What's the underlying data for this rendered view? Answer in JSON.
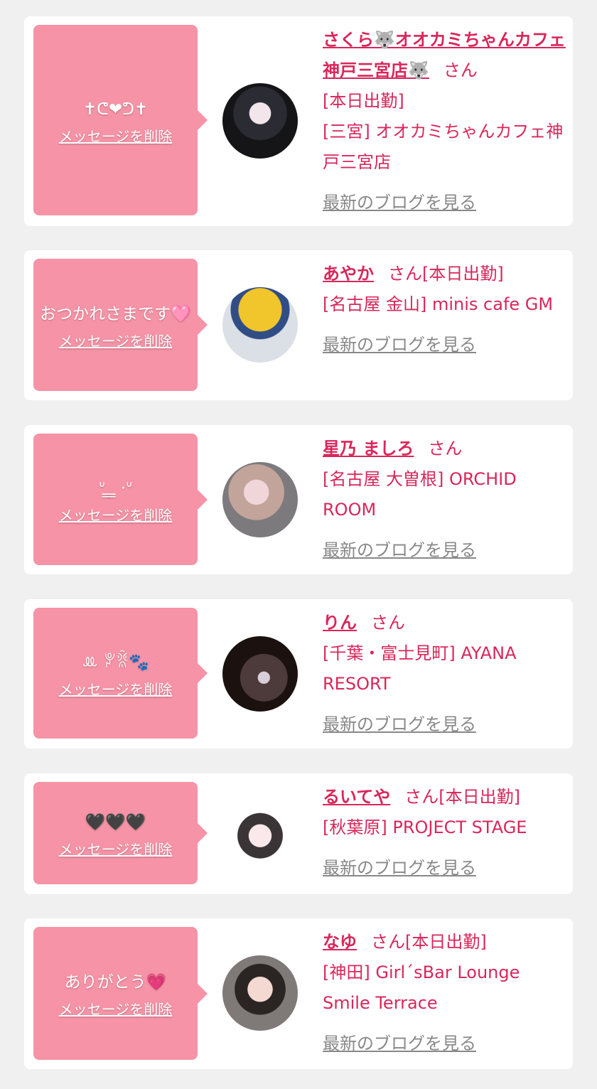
{
  "cards": [
    {
      "message": "✝ᕦ❤ᕤ✝",
      "delete_label": "メッセージを削除",
      "name": "さくら🐺オオカミちゃんカフェ神戸三宮店🐺",
      "san": "さん",
      "status": "[本日出勤]",
      "shop": "[三宮] オオカミちゃんカフェ神戸三宮店",
      "blog_label": "最新のブログを見る"
    },
    {
      "message": "おつかれさまです🩷",
      "delete_label": "メッセージを削除",
      "name": "あやか",
      "san": "さん",
      "status": "[本日出勤]",
      "shop": "[名古屋 金山] minis cafe GM",
      "blog_label": "最新のブログを見る"
    },
    {
      "message": "ᐡ ̳ ̳ ·ᐡ",
      "delete_label": "メッセージを削除",
      "name": "星乃 ましろ",
      "san": "さん",
      "status": "",
      "shop": "[名古屋 大曽根] ORCHID ROOM",
      "blog_label": "最新のブログを見る"
    },
    {
      "message": "ꔛ ꐕꐠ🐾",
      "delete_label": "メッセージを削除",
      "name": "りん",
      "san": "さん",
      "status": "",
      "shop": "[千葉・富士見町] AYANA RESORT",
      "blog_label": "最新のブログを見る"
    },
    {
      "message": "🖤🖤🖤",
      "delete_label": "メッセージを削除",
      "name": "るいてや",
      "san": "さん",
      "status": "[本日出勤]",
      "shop": "[秋葉原] PROJECT STAGE",
      "blog_label": "最新のブログを見る"
    },
    {
      "message": "ありがとう💗",
      "delete_label": "メッセージを削除",
      "name": "なゆ",
      "san": "さん",
      "status": "[本日出勤]",
      "shop": "[神田] Girl´sBar Lounge Smile Terrace",
      "blog_label": "最新のブログを見る"
    }
  ]
}
